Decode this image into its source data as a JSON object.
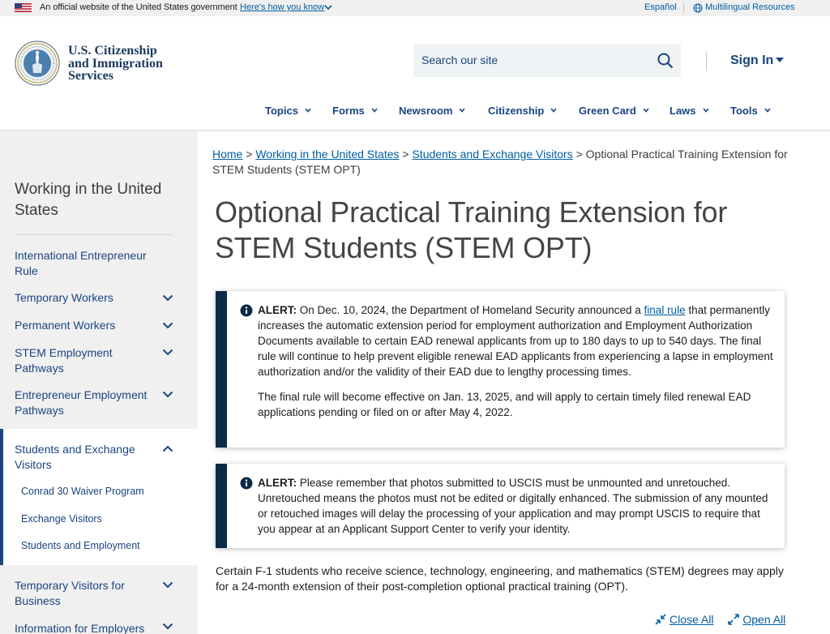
{
  "gov_banner": {
    "official": "An official website of the United States government",
    "how_link": "Here's how you know",
    "espanol": "Español",
    "multilingual": "Multilingual Resources"
  },
  "header": {
    "logo_line1": "U.S. Citizenship",
    "logo_line2": "and Immigration",
    "logo_line3": "Services",
    "search_placeholder": "Search our site",
    "sign_in": "Sign In"
  },
  "nav": {
    "items": [
      "Topics",
      "Forms",
      "Newsroom",
      "Citizenship",
      "Green Card",
      "Laws",
      "Tools"
    ]
  },
  "sidebar": {
    "title": "Working in the United States",
    "items": [
      {
        "label": "International Entrepreneur Rule"
      },
      {
        "label": "Temporary Workers"
      },
      {
        "label": "Permanent Workers"
      },
      {
        "label": "STEM Employment Pathways"
      },
      {
        "label": "Entrepreneur Employment Pathways"
      },
      {
        "label": "Students and Exchange Visitors"
      },
      {
        "label": "Temporary Visitors for Business"
      },
      {
        "label": "Information for Employers"
      }
    ],
    "subitems": [
      "Conrad 30 Waiver Program",
      "Exchange Visitors",
      "Students and Employment"
    ]
  },
  "breadcrumb": {
    "home": "Home",
    "level1": "Working in the United States",
    "level2": "Students and Exchange Visitors",
    "current": "Optional Practical Training Extension for STEM Students (STEM OPT)",
    "sep": ">"
  },
  "page": {
    "title": "Optional Practical Training Extension for STEM Students (STEM OPT)",
    "alert1": {
      "label": "ALERT:",
      "text_before": "On Dec. 10, 2024, the Department of Homeland Security announced a",
      "link": "final rule",
      "text_after": "that permanently increases the automatic extension period for employment authorization and Employment Authorization Documents available to certain EAD renewal applicants from up to 180 days to up to 540 days. The final rule will continue to help prevent eligible renewal EAD applicants from experiencing a lapse in employment authorization and/or the validity of their EAD due to lengthy processing times.",
      "para2": "The final rule will become effective on Jan. 13, 2025, and will apply to certain timely filed renewal EAD applications pending or filed on or after May 4, 2022."
    },
    "alert2": {
      "label": "ALERT:",
      "text": "Please remember that photos submitted to USCIS must be unmounted and unretouched. Unretouched means the photos must not be edited or digitally enhanced. The submission of any mounted or retouched images will delay the processing of your application and may prompt USCIS to require that you appear at an Applicant Support Center to verify your identity."
    },
    "intro": "Certain F-1 students who receive science, technology, engineering, and mathematics (STEM) degrees may apply for a 24-month extension of their post-completion optional practical training (OPT).",
    "close_all": "Close All",
    "open_all": "Open All"
  }
}
